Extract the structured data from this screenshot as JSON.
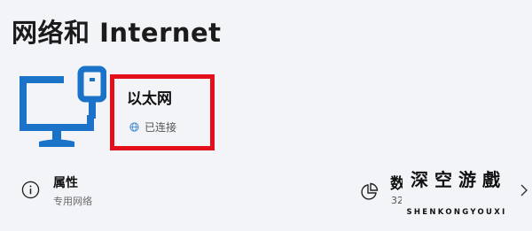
{
  "page": {
    "title": "网络和 Internet"
  },
  "adapter": {
    "name": "以太网",
    "status": "已连接",
    "icon": "monitor-ethernet-icon",
    "status_icon": "globe-icon",
    "highlight_color": "#e3101b",
    "accent_color": "#1a73c8"
  },
  "properties": {
    "title": "属性",
    "subtitle": "专用网络",
    "icon": "info-icon"
  },
  "data_usage": {
    "title_partial": "数",
    "subtitle_partial": "32",
    "icon": "pie-chart-icon"
  },
  "watermark": {
    "chars": [
      "深",
      "空",
      "游",
      "戲"
    ],
    "text": "SHENKONGYOUXI"
  }
}
